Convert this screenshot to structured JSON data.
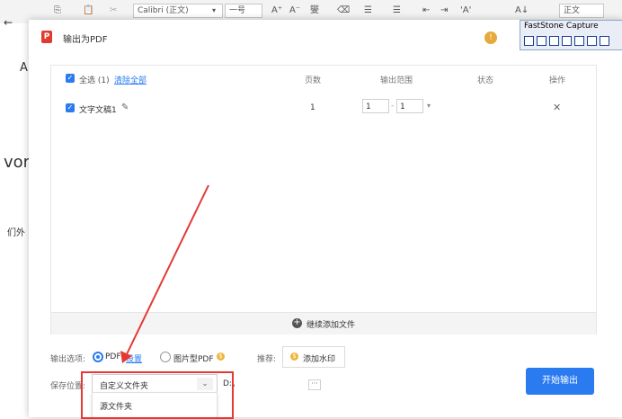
{
  "toolbar": {
    "font_name": "Calibri (正文)",
    "font_size": "一号",
    "grow": "A⁺",
    "shrink": "A⁻",
    "phonetic": "燮",
    "list_a": "☰",
    "list_b": "☰",
    "indent_dec": "⇤",
    "indent_inc": "⇥",
    "case": "'A'",
    "sort": "A↓",
    "style_box": "正文"
  },
  "background": {
    "text_a": "A",
    "text_vor": "vor",
    "text_cn": "们外",
    "arrow": "←"
  },
  "dialog": {
    "icon_letter": "P",
    "title": "输出为PDF",
    "help_symbol": "!"
  },
  "faststone": {
    "title": "FastStone Capture"
  },
  "list": {
    "select_all": "全选 (1)",
    "clear_all": "清除全部",
    "col_pages": "页数",
    "col_range": "输出范围",
    "col_status": "状态",
    "col_action": "操作",
    "rows": [
      {
        "name": "文字文稿1",
        "pages": "1",
        "range_from": "1",
        "range_to": "1",
        "delete": "✕"
      }
    ],
    "add_symbol": "+",
    "add_files": "继续添加文件"
  },
  "options": {
    "output_label": "输出选项:",
    "pdf_label": "PDF",
    "settings_link": "设置",
    "image_pdf_label": "图片型PDF",
    "coin_symbol": "$",
    "recommend_label": "推荐:",
    "watermark_label": "添加水印",
    "save_label": "保存位置:",
    "save_select": "自定义文件夹",
    "save_path": "D:\\",
    "browse": "···",
    "dropdown_options": [
      "源文件夹"
    ],
    "start_button": "开始输出"
  },
  "colors": {
    "accent": "#2b7bf0",
    "highlight": "#e53935"
  }
}
